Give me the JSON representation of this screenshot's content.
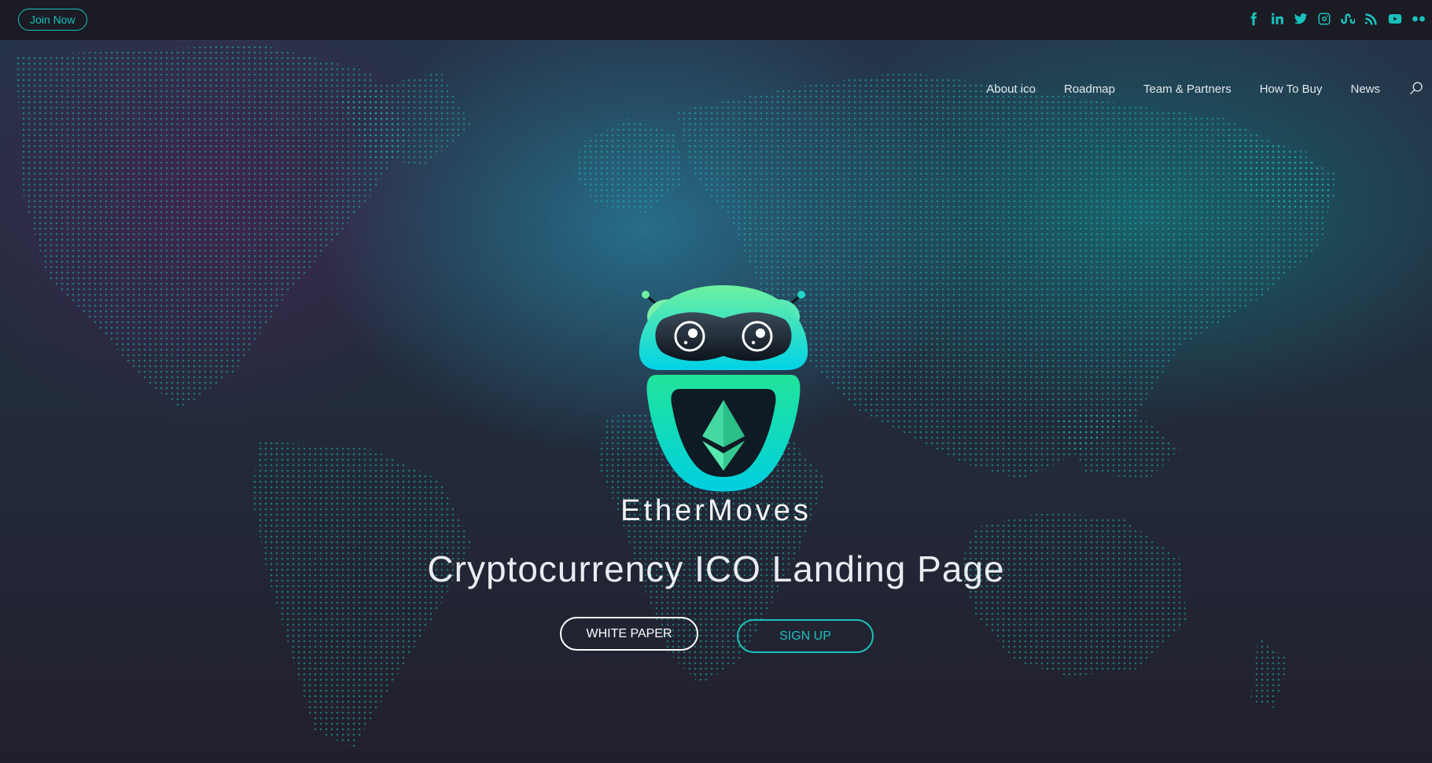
{
  "topbar": {
    "join_label": "Join Now",
    "socials": [
      "facebook-icon",
      "linkedin-icon",
      "twitter-icon",
      "instagram-icon",
      "stumbleupon-icon",
      "rss-icon",
      "youtube-icon",
      "flickr-icon"
    ]
  },
  "nav": {
    "items": [
      "About ico",
      "Roadmap",
      "Team & Partners",
      "How To Buy",
      "News"
    ]
  },
  "hero": {
    "brand": "EtherMoves",
    "headline": "Cryptocurrency ICO Landing Page",
    "white_paper_label": "WHITE PAPER",
    "sign_up_label": "SIGN UP"
  },
  "colors": {
    "accent": "#19c2bd",
    "topbar": "#1a1b23",
    "robot_green": "#2ee89a",
    "robot_cyan": "#00d4e0"
  }
}
